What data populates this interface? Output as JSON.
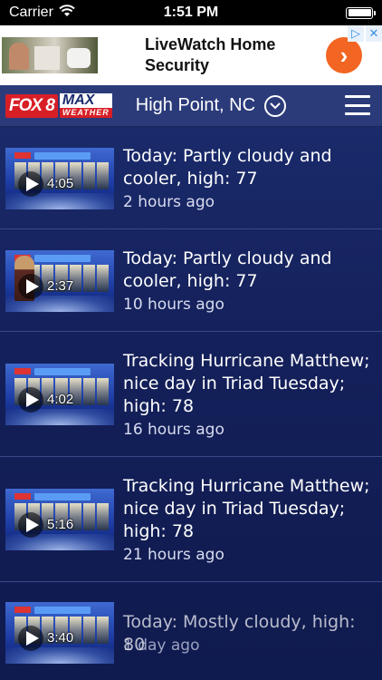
{
  "status_bar": {
    "carrier": "Carrier",
    "time": "1:51 PM"
  },
  "ad": {
    "headline_line1": "LiveWatch Home",
    "headline_line2": "Security",
    "arrow_glyph": "›",
    "badge_play": "▷",
    "badge_close": "✕"
  },
  "nav": {
    "logo_fox": "FOX 8",
    "logo_max": "MAX",
    "logo_weather": "WEATHER",
    "location": "High Point, NC"
  },
  "videos": [
    {
      "title": "Today: Partly cloudy and cooler, high: 77",
      "time": "2 hours ago",
      "duration": "4:05",
      "has_presenter": false
    },
    {
      "title": "Today: Partly cloudy and cooler, high: 77",
      "time": "10 hours ago",
      "duration": "2:37",
      "has_presenter": true
    },
    {
      "title": "Tracking Hurricane Matthew; nice day in Triad Tuesday; high: 78",
      "time": "16 hours ago",
      "duration": "4:02",
      "has_presenter": false
    },
    {
      "title": "Tracking Hurricane Matthew; nice day in Triad Tuesday; high: 78",
      "time": "21 hours ago",
      "duration": "5:16",
      "has_presenter": false
    },
    {
      "title": "Today: Mostly cloudy, high: 80",
      "time": "1 day ago",
      "duration": "3:40",
      "has_presenter": false
    }
  ],
  "colors": {
    "nav_bg": "#2b3b7a",
    "list_bg": "#14205a",
    "ad_arrow": "#f26522",
    "fox_red": "#d81f26"
  }
}
